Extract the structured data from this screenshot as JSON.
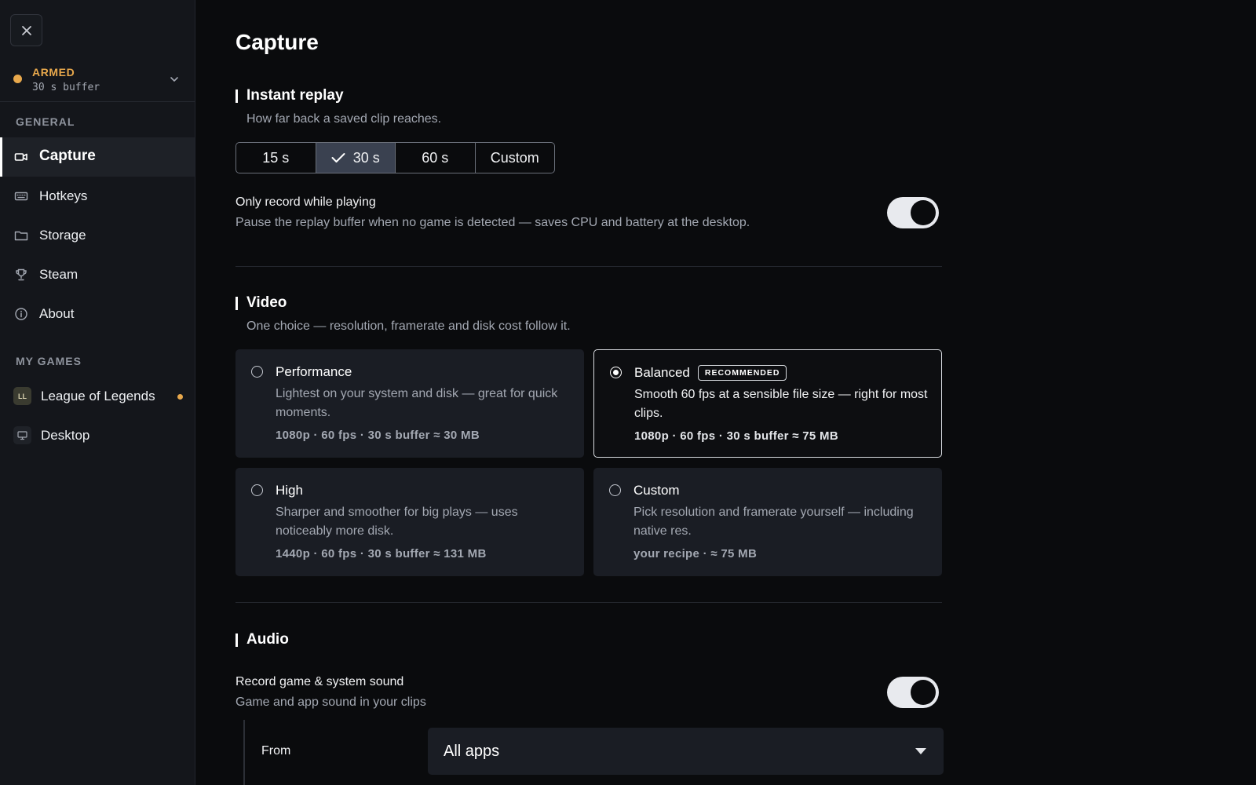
{
  "sidebar": {
    "close_icon": "close-icon",
    "status": {
      "state": "ARMED",
      "buffer": "30 s buffer",
      "color": "#e8a84c"
    },
    "general_label": "GENERAL",
    "items": [
      {
        "label": "Capture",
        "icon": "video-camera-icon",
        "active": true
      },
      {
        "label": "Hotkeys",
        "icon": "keyboard-icon"
      },
      {
        "label": "Storage",
        "icon": "folder-icon"
      },
      {
        "label": "Steam",
        "icon": "trophy-icon"
      },
      {
        "label": "About",
        "icon": "info-icon"
      }
    ],
    "games_label": "MY GAMES",
    "games": [
      {
        "label": "League of Legends",
        "icon_text": "LL",
        "has_indicator": true
      },
      {
        "label": "Desktop",
        "icon": "monitor-icon"
      }
    ]
  },
  "main": {
    "title": "Capture",
    "instant_replay": {
      "title": "Instant replay",
      "description": "How far back a saved clip reaches.",
      "options": [
        "15 s",
        "30 s",
        "60 s",
        "Custom"
      ],
      "selected": "30 s"
    },
    "only_record": {
      "title": "Only record while playing",
      "description": "Pause the replay buffer when no game is detected — saves CPU and battery at the desktop.",
      "enabled": true
    },
    "video": {
      "title": "Video",
      "description": "One choice — resolution, framerate and disk cost follow it.",
      "presets": [
        {
          "title": "Performance",
          "description": "Lightest on your system and disk — great for quick moments.",
          "spec": "1080p · 60 fps · 30 s buffer ≈ 30 MB",
          "selected": false
        },
        {
          "title": "Balanced",
          "badge": "RECOMMENDED",
          "description": "Smooth 60 fps at a sensible file size — right for most clips.",
          "spec": "1080p · 60 fps · 30 s buffer ≈ 75 MB",
          "selected": true
        },
        {
          "title": "High",
          "description": "Sharper and smoother for big plays — uses noticeably more disk.",
          "spec": "1440p · 60 fps · 30 s buffer ≈ 131 MB",
          "selected": false
        },
        {
          "title": "Custom",
          "description": "Pick resolution and framerate yourself — including native res.",
          "spec": "your recipe · ≈ 75 MB",
          "selected": false
        }
      ]
    },
    "audio": {
      "title": "Audio",
      "record_sound": {
        "title": "Record game & system sound",
        "description": "Game and app sound in your clips",
        "enabled": true
      },
      "from_label": "From",
      "from_value": "All apps"
    }
  }
}
